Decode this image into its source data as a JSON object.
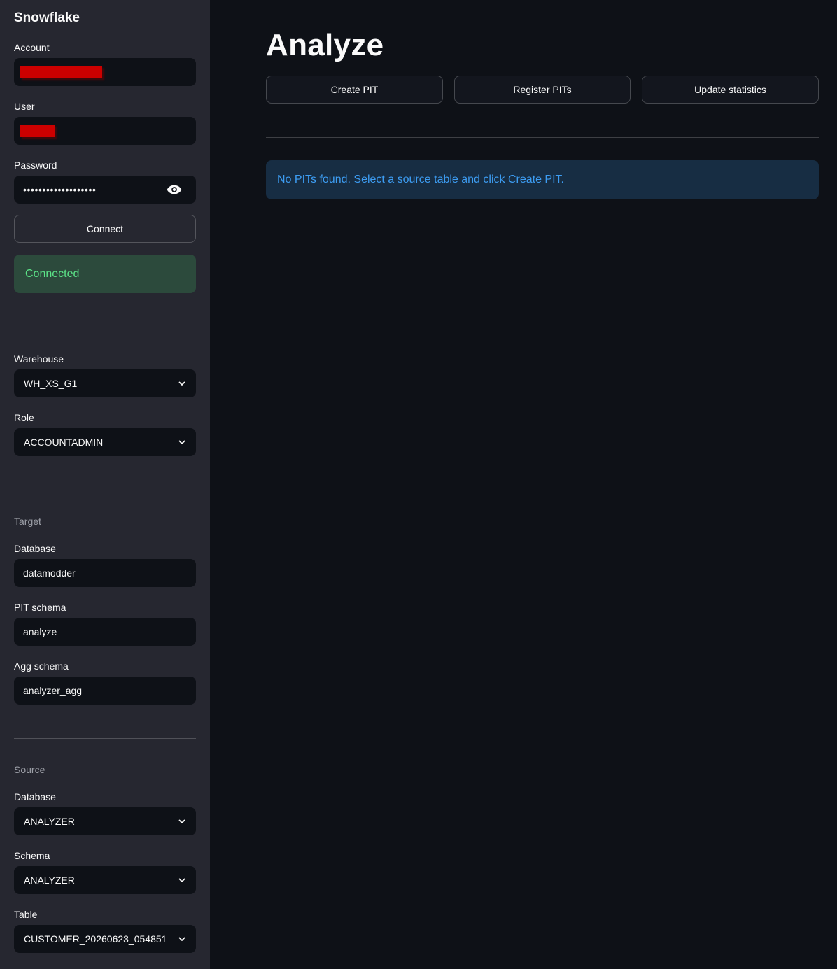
{
  "sidebar": {
    "title": "Snowflake",
    "account": {
      "label": "Account",
      "value": ""
    },
    "user": {
      "label": "User",
      "value": ""
    },
    "password": {
      "label": "Password",
      "value": "•••••••••••••••••••"
    },
    "connect_label": "Connect",
    "status": "Connected",
    "warehouse": {
      "label": "Warehouse",
      "value": "WH_XS_G1"
    },
    "role": {
      "label": "Role",
      "value": "ACCOUNTADMIN"
    },
    "target": {
      "section_label": "Target",
      "database": {
        "label": "Database",
        "value": "datamodder"
      },
      "pit_schema": {
        "label": "PIT schema",
        "value": "analyze"
      },
      "agg_schema": {
        "label": "Agg schema",
        "value": "analyzer_agg"
      }
    },
    "source": {
      "section_label": "Source",
      "database": {
        "label": "Database",
        "value": "ANALYZER"
      },
      "schema": {
        "label": "Schema",
        "value": "ANALYZER"
      },
      "table": {
        "label": "Table",
        "value": "CUSTOMER_20260623_054851"
      }
    }
  },
  "main": {
    "title": "Analyze",
    "buttons": [
      "Create PIT",
      "Register PITs",
      "Update statistics"
    ],
    "info_message": "No PITs found. Select a source table and click Create PIT."
  },
  "colors": {
    "background": "#0e1117",
    "sidebar": "#262730",
    "success_bg": "#2c4a3c",
    "success_text": "#5ce488",
    "info_bg": "#172d43",
    "info_text": "#3d9df3",
    "redaction": "#cc0000"
  },
  "icons": {
    "password_toggle": "eye-icon",
    "select": "chevron-down-icon"
  }
}
